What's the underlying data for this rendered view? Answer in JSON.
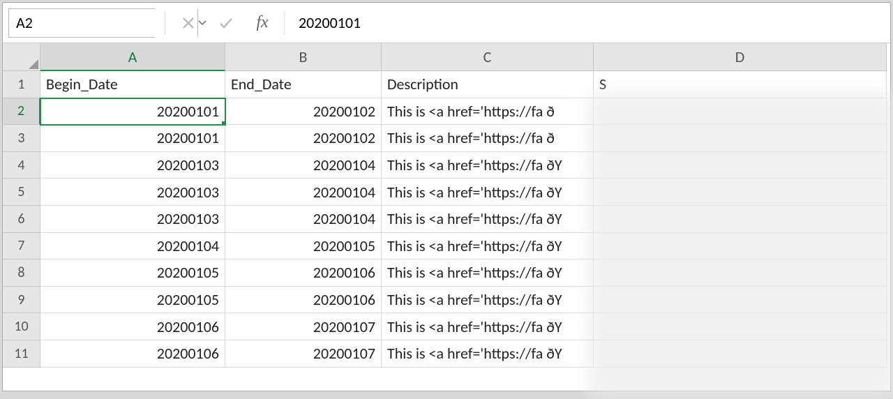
{
  "namebox": {
    "value": "A2"
  },
  "formula_bar": {
    "fx_label": "fx",
    "value": "20200101"
  },
  "columns": [
    {
      "letter": "A",
      "selected": true,
      "width_class": "col-A"
    },
    {
      "letter": "B",
      "selected": false,
      "width_class": "col-B"
    },
    {
      "letter": "C",
      "selected": false,
      "width_class": "col-C"
    },
    {
      "letter": "D",
      "selected": false,
      "width_class": "col-D"
    }
  ],
  "header_row": {
    "A": "Begin_Date",
    "B": "End_Date",
    "C": "Description",
    "D": "S"
  },
  "rows": [
    {
      "n": 1,
      "selected": false,
      "A": "Begin_Date",
      "B": "End_Date",
      "C": "Description",
      "D": "S",
      "A_align": "left",
      "B_align": "left",
      "is_header": true
    },
    {
      "n": 2,
      "selected": true,
      "A": "20200101",
      "B": "20200102",
      "C": "This is <a href='https://fa ð",
      "D": ""
    },
    {
      "n": 3,
      "selected": false,
      "A": "20200101",
      "B": "20200102",
      "C": "This is <a href='https://fa ð",
      "D": ""
    },
    {
      "n": 4,
      "selected": false,
      "A": "20200103",
      "B": "20200104",
      "C": "This is <a href='https://fa ðY",
      "D": ""
    },
    {
      "n": 5,
      "selected": false,
      "A": "20200103",
      "B": "20200104",
      "C": "This is <a href='https://fa ðY",
      "D": ""
    },
    {
      "n": 6,
      "selected": false,
      "A": "20200103",
      "B": "20200104",
      "C": "This is <a href='https://fa ðY",
      "D": ""
    },
    {
      "n": 7,
      "selected": false,
      "A": "20200104",
      "B": "20200105",
      "C": "This is <a href='https://fa ðY",
      "D": ""
    },
    {
      "n": 8,
      "selected": false,
      "A": "20200105",
      "B": "20200106",
      "C": "This is <a href='https://fa ðY",
      "D": ""
    },
    {
      "n": 9,
      "selected": false,
      "A": "20200105",
      "B": "20200106",
      "C": "This is <a href='https://fa ðY",
      "D": ""
    },
    {
      "n": 10,
      "selected": false,
      "A": "20200106",
      "B": "20200107",
      "C": "This is <a href='https://fa ðY",
      "D": ""
    },
    {
      "n": 11,
      "selected": false,
      "A": "20200106",
      "B": "20200107",
      "C": "This is <a href='https://fa ðY",
      "D": ""
    }
  ],
  "selected_cell": {
    "row": 2,
    "col": "A"
  }
}
